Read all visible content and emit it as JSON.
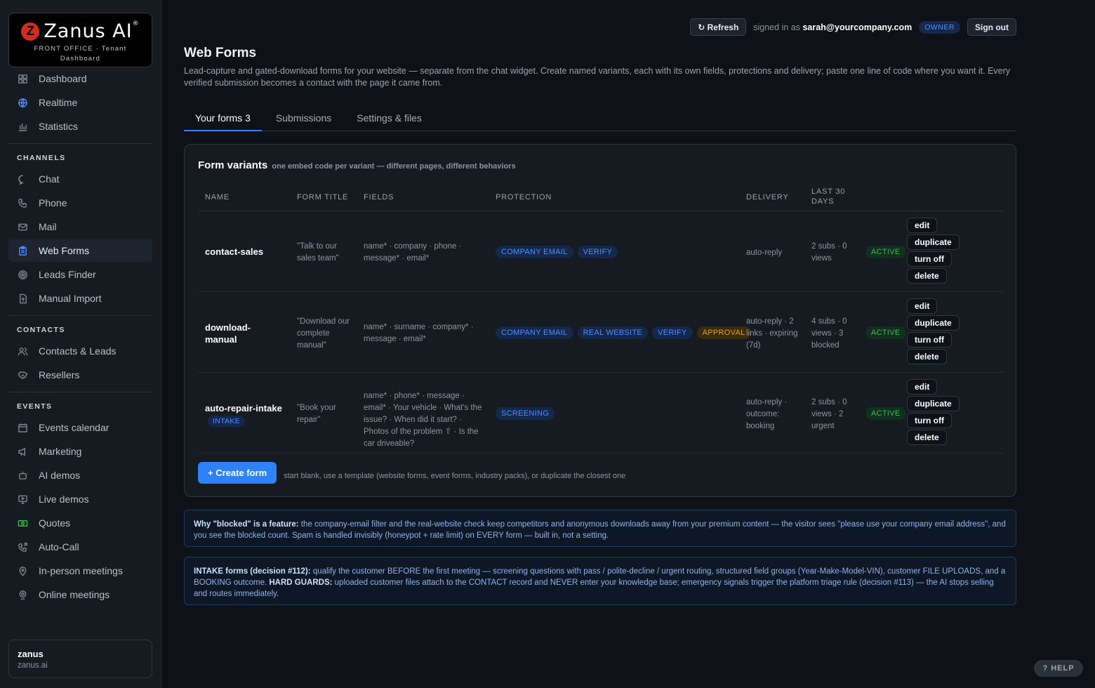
{
  "brand": {
    "name": "Zanus AI",
    "sub1": "FRONT OFFICE · Tenant",
    "sub2": "Dashboard"
  },
  "sidebar": {
    "top": [
      {
        "label": "Dashboard",
        "icon": "dashboard-icon"
      },
      {
        "label": "Realtime",
        "icon": "globe-icon"
      },
      {
        "label": "Statistics",
        "icon": "bar-chart-icon"
      }
    ],
    "channels_title": "CHANNELS",
    "channels": [
      {
        "label": "Chat",
        "icon": "chat-icon"
      },
      {
        "label": "Phone",
        "icon": "phone-icon"
      },
      {
        "label": "Mail",
        "icon": "mail-icon"
      },
      {
        "label": "Web Forms",
        "icon": "clipboard-icon",
        "active": true
      },
      {
        "label": "Leads Finder",
        "icon": "target-icon"
      },
      {
        "label": "Manual Import",
        "icon": "file-upload-icon"
      }
    ],
    "contacts_title": "CONTACTS",
    "contacts": [
      {
        "label": "Contacts & Leads",
        "icon": "users-icon"
      },
      {
        "label": "Resellers",
        "icon": "handshake-icon"
      }
    ],
    "events_title": "EVENTS",
    "events": [
      {
        "label": "Events calendar",
        "icon": "calendar-icon"
      },
      {
        "label": "Marketing",
        "icon": "megaphone-icon"
      },
      {
        "label": "AI demos",
        "icon": "robot-icon"
      },
      {
        "label": "Live demos",
        "icon": "monitor-icon"
      },
      {
        "label": "Quotes",
        "icon": "money-icon"
      },
      {
        "label": "Auto-Call",
        "icon": "phone-outgoing-icon"
      },
      {
        "label": "In-person meetings",
        "icon": "map-pin-icon"
      },
      {
        "label": "Online meetings",
        "icon": "video-pin-icon"
      }
    ],
    "user": {
      "name": "zanus",
      "domain": "zanus.ai"
    }
  },
  "header": {
    "refresh": "↻ Refresh",
    "signed_prefix": "signed in as",
    "email": "sarah@yourcompany.com",
    "role": "OWNER",
    "signout": "Sign out"
  },
  "page": {
    "title": "Web Forms",
    "description": "Lead-capture and gated-download forms for your website — separate from the chat widget. Create named variants, each with its own fields, protections and delivery; paste one line of code where you want it. Every verified submission becomes a contact with the page it came from."
  },
  "tabs": [
    {
      "label": "Your forms 3",
      "active": true
    },
    {
      "label": "Submissions"
    },
    {
      "label": "Settings & files"
    }
  ],
  "card": {
    "title": "Form variants",
    "subtitle": "one embed code per variant — different pages, different behaviors",
    "columns": {
      "name": "NAME",
      "form_title": "FORM TITLE",
      "fields": "FIELDS",
      "protection": "PROTECTION",
      "delivery": "DELIVERY",
      "last30": "LAST 30 DAYS"
    },
    "rows": [
      {
        "name": "contact-sales",
        "tag": "",
        "form_title": "\"Talk to our sales team\"",
        "fields": "name* · company · phone · message* · email*",
        "protection": [
          {
            "label": "COMPANY EMAIL",
            "color": "blue"
          },
          {
            "label": "VERIFY",
            "color": "blue"
          }
        ],
        "delivery": "auto-reply",
        "last30": "2 subs · 0 views",
        "status": "ACTIVE"
      },
      {
        "name": "download-manual",
        "tag": "",
        "form_title": "\"Download our complete manual\"",
        "fields": "name* · surname · company* · message · email*",
        "protection": [
          {
            "label": "COMPANY EMAIL",
            "color": "blue"
          },
          {
            "label": "REAL WEBSITE",
            "color": "blue"
          },
          {
            "label": "VERIFY",
            "color": "blue"
          },
          {
            "label": "APPROVAL",
            "color": "amber"
          }
        ],
        "delivery": "auto-reply · 2 links · expiring (7d)",
        "last30": "4 subs · 0 views · 3 blocked",
        "status": "ACTIVE"
      },
      {
        "name": "auto-repair-intake",
        "tag": "INTAKE",
        "form_title": "\"Book your repair\"",
        "fields": "name* · phone* · message · email* · Your vehicle · What's the issue? · When did it start? · Photos of the problem ⇧ · Is the car driveable?",
        "protection": [
          {
            "label": "SCREENING",
            "color": "blue"
          }
        ],
        "delivery": "auto-reply · outcome: booking",
        "last30": "2 subs · 0 views · 2 urgent",
        "status": "ACTIVE"
      }
    ],
    "actions": {
      "edit": "edit",
      "duplicate": "duplicate",
      "turn_off": "turn off",
      "delete": "delete"
    },
    "create_label": "+ Create form",
    "create_hint": "start blank, use a template (website forms, event forms, industry packs), or duplicate the closest one"
  },
  "notes": {
    "blocked_title": "Why \"blocked\" is a feature:",
    "blocked_text": " the company-email filter and the real-website check keep competitors and anonymous downloads away from your premium content — the visitor sees \"please use your company email address\", and you see the blocked count. Spam is handled invisibly (honeypot + rate limit) on EVERY form — built in, not a setting.",
    "intake_title": "INTAKE forms (decision #112):",
    "intake_text1": " qualify the customer BEFORE the first meeting — screening questions with pass / polite-decline / urgent routing, structured field groups (Year-Make-Model-VIN), customer FILE UPLOADS, and a BOOKING outcome. ",
    "intake_guard": "HARD GUARDS:",
    "intake_text2": " uploaded customer files attach to the CONTACT record and NEVER enter your knowledge base; emergency signals trigger the platform triage rule (decision #113) — the AI stops selling and routes immediately."
  },
  "help": "? HELP",
  "colors": {
    "accent": "#2f81f7",
    "bg": "#0e1117",
    "panel": "#161b22",
    "active_green": "#3fb950",
    "approval_amber": "#e3a22d"
  }
}
